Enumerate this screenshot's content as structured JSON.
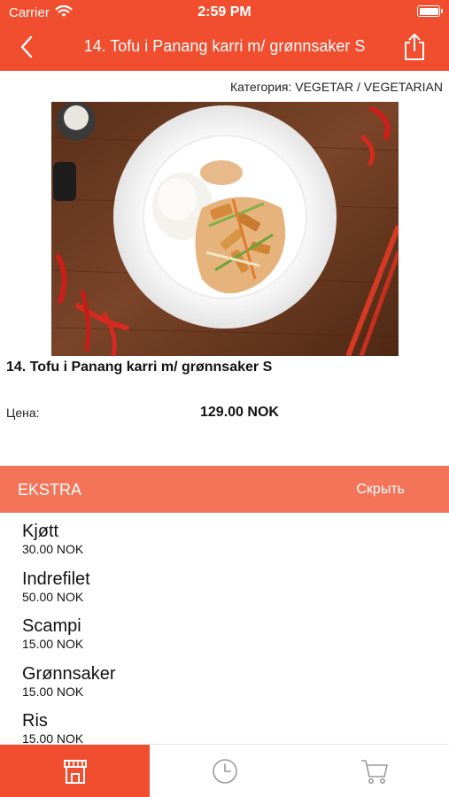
{
  "status_bar": {
    "carrier": "Carrier",
    "time": "2:59 PM"
  },
  "navbar": {
    "title": "14. Tofu i Panang karri m/ grønnsaker S",
    "back_icon": "chevron-left-icon",
    "share_icon": "share-icon"
  },
  "product": {
    "category": "Категория: VEGETAR / VEGETARIAN",
    "name": "14. Tofu i Panang karri m/ grønnsaker S",
    "price_label": "Цена:",
    "price": "129.00 NOK"
  },
  "extras": {
    "title": "EKSTRA",
    "hide_label": "Скрыть",
    "items": [
      {
        "name": "Kjøtt",
        "price": "30.00 NOK"
      },
      {
        "name": "Indrefilet",
        "price": "50.00 NOK"
      },
      {
        "name": "Scampi",
        "price": "15.00 NOK"
      },
      {
        "name": "Grønnsaker",
        "price": "15.00 NOK"
      },
      {
        "name": "Ris",
        "price": "15.00 NOK"
      }
    ]
  },
  "tabbar": {
    "tabs": [
      {
        "icon": "store-icon",
        "active": true
      },
      {
        "icon": "clock-icon",
        "active": false
      },
      {
        "icon": "cart-icon",
        "active": false
      }
    ]
  },
  "colors": {
    "primary": "#f04e2f",
    "extra_bar": "#f37458"
  }
}
